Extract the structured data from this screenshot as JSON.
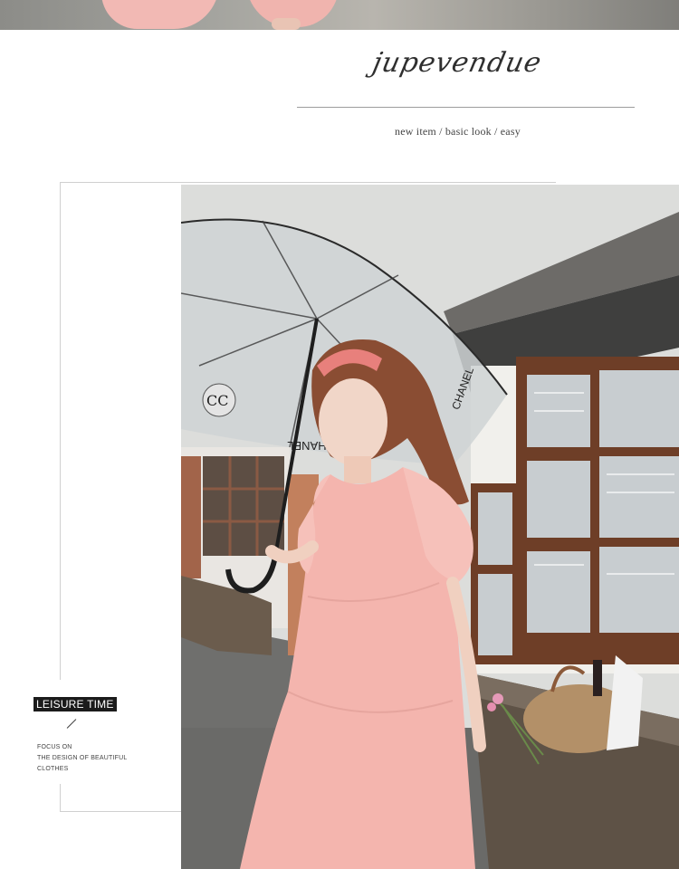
{
  "header": {
    "brand": "jupevendue",
    "tagline": "new item / basic look / easy"
  },
  "side_caption": {
    "badge": "LEISURE TIME",
    "lines": [
      "FOCUS ON",
      "THE DESIGN OF BEAUTIFUL",
      "CLOTHES"
    ]
  },
  "photo": {
    "umbrella_print": "CHANEL",
    "subject": "woman in pink puff-sleeve dress holding clear umbrella"
  },
  "colors": {
    "dress": "#f4b5ae",
    "background": "#ffffff",
    "badge": "#1b1b1b"
  }
}
